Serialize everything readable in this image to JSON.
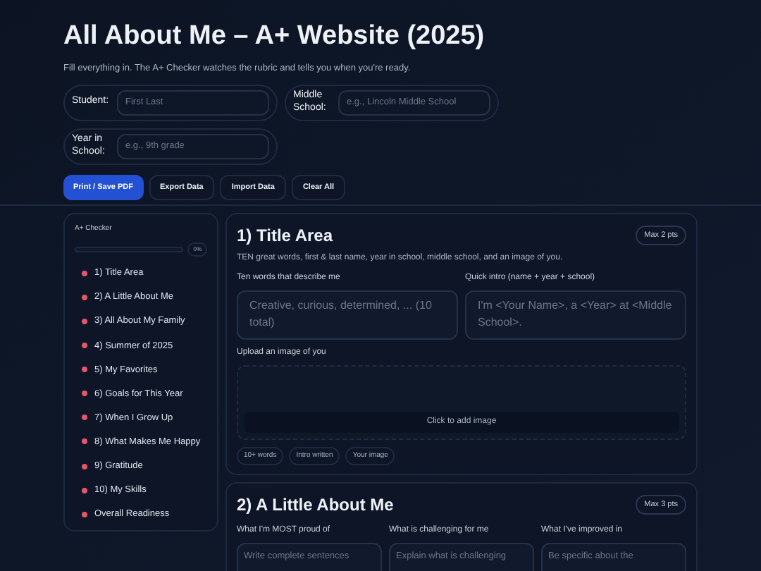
{
  "header": {
    "title": "All About Me – A+ Website (2025)",
    "subtitle": "Fill everything in. The A+ Checker watches the rubric and tells you when you're ready."
  },
  "fields": [
    {
      "label": "Student:",
      "placeholder": "First Last"
    },
    {
      "label": "Middle School:",
      "placeholder": "e.g., Lincoln Middle School"
    },
    {
      "label": "Year in School:",
      "placeholder": "e.g., 9th grade"
    }
  ],
  "buttons": [
    {
      "label": "Print / Save PDF",
      "kind": "primary"
    },
    {
      "label": "Export Data",
      "kind": "secondary"
    },
    {
      "label": "Import Data",
      "kind": "secondary"
    },
    {
      "label": "Clear All",
      "kind": "secondary"
    }
  ],
  "checker": {
    "title": "A+ Checker",
    "progress": {
      "level": 0,
      "reading": "0%"
    },
    "items": [
      {
        "label": "1) Title Area",
        "done": false
      },
      {
        "label": "2) A Little About Me",
        "done": false
      },
      {
        "label": "3) All About My Family",
        "done": false
      },
      {
        "label": "4) Summer of 2025",
        "done": false
      },
      {
        "label": "5) My Favorites",
        "done": false
      },
      {
        "label": "6) Goals for This Year",
        "done": false
      },
      {
        "label": "7) When I Grow Up",
        "done": false
      },
      {
        "label": "8) What Makes Me Happy",
        "done": false
      },
      {
        "label": "9) Gratitude",
        "done": false
      },
      {
        "label": "10) My Skills",
        "done": false
      },
      {
        "label": "Overall Readiness",
        "done": false
      }
    ]
  },
  "sections": [
    {
      "title": "1) Title Area",
      "points": "Max 2 pts",
      "description": "TEN great words, first & last name, year in school, middle school, and an image of you.",
      "fields": [
        {
          "label": "Ten words that describe me",
          "placeholder": "Creative, curious, determined, ... (10 total)"
        },
        {
          "label": "Quick intro (name + year + school)",
          "placeholder": "I'm <Your Name>, a <Year> at <Middle School>."
        }
      ],
      "upload": {
        "label": "Upload an image of you",
        "button": "Click to add image"
      },
      "chips": [
        "10+ words",
        "Intro written",
        "Your image"
      ]
    },
    {
      "title": "2) A Little About Me",
      "points": "Max 3 pts",
      "fields": [
        {
          "label": "What I'm MOST proud of",
          "placeholder": "Write complete sentences"
        },
        {
          "label": "What is challenging for me",
          "placeholder": "Explain what is challenging"
        },
        {
          "label": "What I've improved in",
          "placeholder": "Be specific about the"
        }
      ]
    }
  ]
}
